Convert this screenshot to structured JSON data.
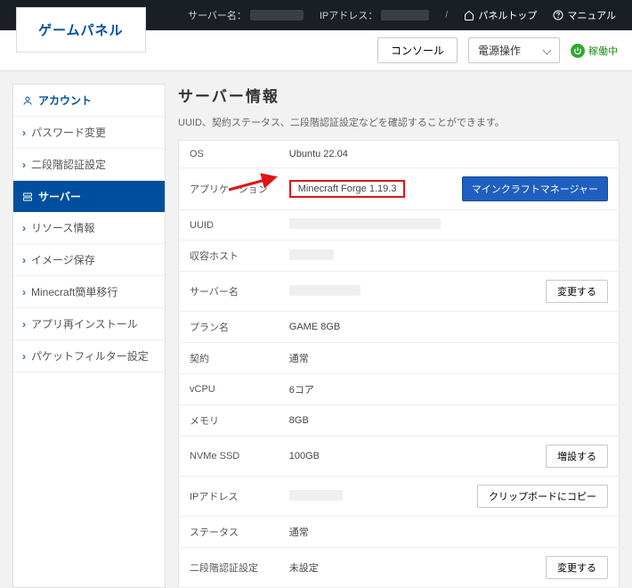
{
  "topbar": {
    "server_name_label": "サーバー名：",
    "ip_label": "IPアドレス：",
    "panel_top": "パネルトップ",
    "manual": "マニュアル"
  },
  "logo": "ゲームパネル",
  "actionbar": {
    "console": "コンソール",
    "power": "電源操作",
    "status": "稼働中"
  },
  "sidebar": {
    "account_head": "アカウント",
    "account_items": [
      "パスワード変更",
      "二段階認証設定"
    ],
    "server_head": "サーバー",
    "server_items": [
      "リソース情報",
      "イメージ保存",
      "Minecraft簡単移行",
      "アプリ再インストール",
      "パケットフィルター設定"
    ]
  },
  "page": {
    "title": "サーバー情報",
    "desc": "UUID、契約ステータス、二段階認証設定などを確認することができます。"
  },
  "rows": {
    "os": {
      "label": "OS",
      "value": "Ubuntu 22.04"
    },
    "app": {
      "label": "アプリケーション",
      "value": "Minecraft Forge 1.19.3",
      "button": "マインクラフトマネージャー"
    },
    "uuid": {
      "label": "UUID"
    },
    "host": {
      "label": "収容ホスト"
    },
    "srvname": {
      "label": "サーバー名",
      "button": "変更する"
    },
    "plan": {
      "label": "プラン名",
      "value": "GAME 8GB"
    },
    "contract": {
      "label": "契約",
      "value": "通常"
    },
    "vcpu": {
      "label": "vCPU",
      "value": "6コア"
    },
    "memory": {
      "label": "メモリ",
      "value": "8GB"
    },
    "ssd": {
      "label": "NVMe SSD",
      "value": "100GB",
      "button": "増設する"
    },
    "ip": {
      "label": "IPアドレス",
      "button": "クリップボードにコピー"
    },
    "status": {
      "label": "ステータス",
      "value": "通常"
    },
    "mfa": {
      "label": "二段階認証設定",
      "value": "未設定",
      "button": "変更する"
    }
  }
}
